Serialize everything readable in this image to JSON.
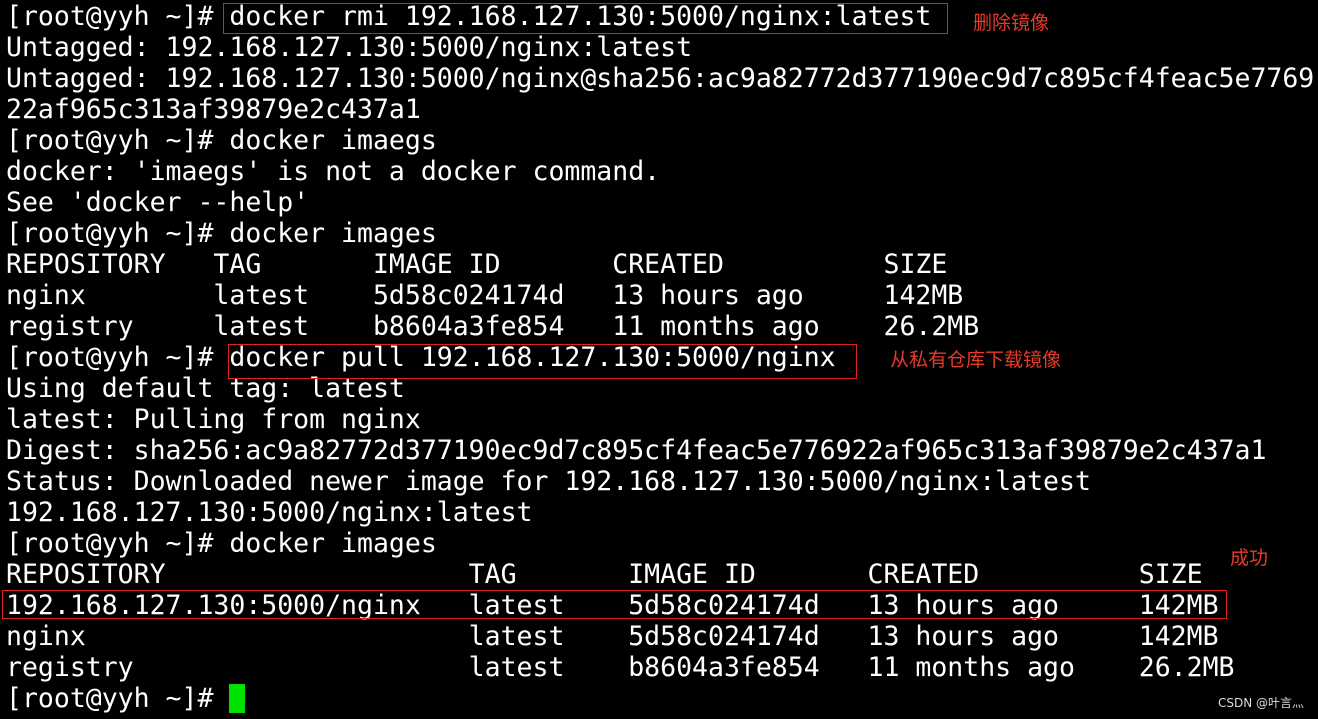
{
  "terminal": {
    "lines": [
      "[root@yyh ~]# docker rmi 192.168.127.130:5000/nginx:latest",
      "Untagged: 192.168.127.130:5000/nginx:latest",
      "Untagged: 192.168.127.130:5000/nginx@sha256:ac9a82772d377190ec9d7c895cf4feac5e7769",
      "22af965c313af39879e2c437a1",
      "[root@yyh ~]# docker imaegs",
      "docker: 'imaegs' is not a docker command.",
      "See 'docker --help'",
      "[root@yyh ~]# docker images",
      "REPOSITORY   TAG       IMAGE ID       CREATED          SIZE",
      "nginx        latest    5d58c024174d   13 hours ago     142MB",
      "registry     latest    b8604a3fe854   11 months ago    26.2MB",
      "[root@yyh ~]# docker pull 192.168.127.130:5000/nginx",
      "Using default tag: latest",
      "latest: Pulling from nginx",
      "Digest: sha256:ac9a82772d377190ec9d7c895cf4feac5e776922af965c313af39879e2c437a1",
      "Status: Downloaded newer image for 192.168.127.130:5000/nginx:latest",
      "192.168.127.130:5000/nginx:latest",
      "[root@yyh ~]# docker images",
      "REPOSITORY                   TAG       IMAGE ID       CREATED          SIZE",
      "192.168.127.130:5000/nginx   latest    5d58c024174d   13 hours ago     142MB",
      "nginx                        latest    5d58c024174d   13 hours ago     142MB",
      "registry                     latest    b8604a3fe854   11 months ago    26.2MB",
      "[root@yyh ~]# "
    ]
  },
  "annotations": {
    "delete_image": "删除镜像",
    "pull_private": "从私有仓库下载镜像",
    "success": "成功"
  },
  "watermark": "CSDN @叶言灬",
  "colors": {
    "background": "#000000",
    "text": "#ffffff",
    "highlight_box": "#e02020",
    "annotation": "#e83a2a",
    "cursor": "#00e000"
  }
}
